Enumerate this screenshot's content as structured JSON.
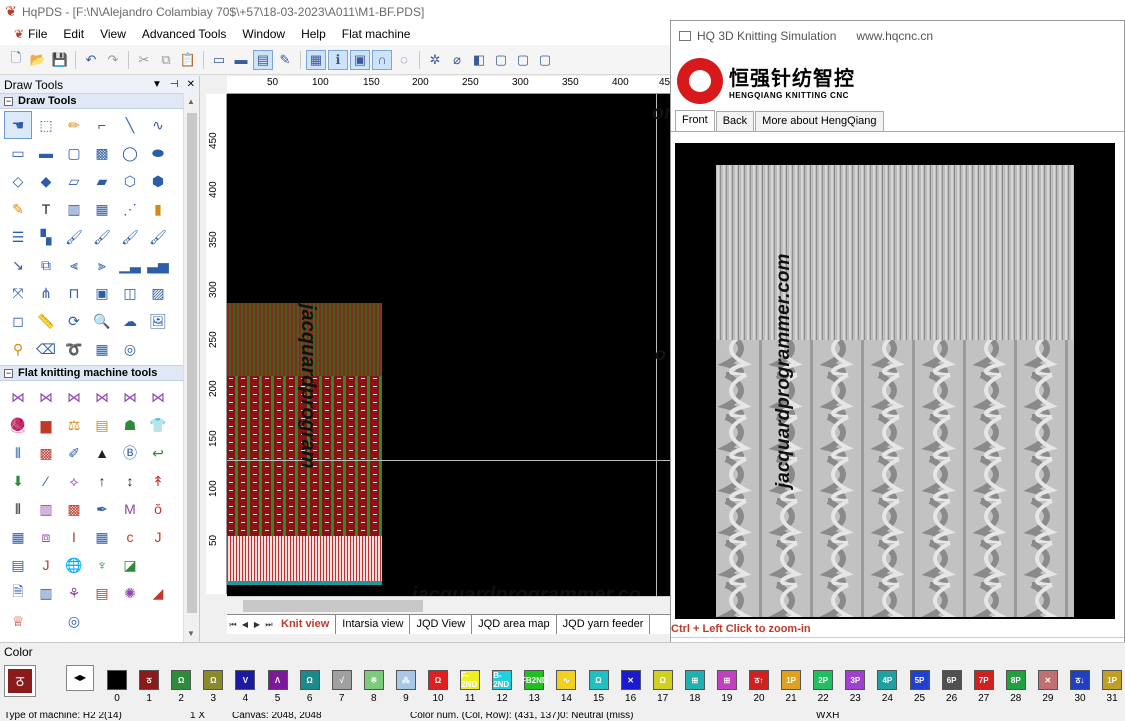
{
  "window": {
    "title": "HqPDS - [F:\\N\\Alejandro Colambiay 70$\\+57\\18-03-2023\\A011\\M1-BF.PDS]"
  },
  "menu": [
    "File",
    "Edit",
    "View",
    "Advanced Tools",
    "Window",
    "Help",
    "Flat machine"
  ],
  "left_panel": {
    "title": "Draw Tools",
    "section1": "Draw Tools",
    "section2": "Flat knitting machine tools"
  },
  "ruler": {
    "h_labels": [
      "50",
      "100",
      "150",
      "200",
      "250",
      "300",
      "350",
      "400",
      "45"
    ],
    "v_labels": [
      "450",
      "400",
      "350",
      "300",
      "250",
      "200",
      "150",
      "100",
      "50"
    ]
  },
  "canvas": {
    "watermark_vertical": "jacquardprogram",
    "watermark_bottom": "jacquardprogrammer.co",
    "watermark_top": "om",
    "watermark_mid": "o"
  },
  "tabs": [
    "Knit view",
    "Intarsia view",
    "JQD View",
    "JQD area map",
    "JQD yarn feeder"
  ],
  "sim": {
    "title": "HQ 3D Knitting Simulation",
    "url": "www.hqcnc.cn",
    "brand_cn": "恒强针纺智控",
    "brand_en": "HENGQIANG KNITTING CNC",
    "tabs": [
      "Front",
      "Back",
      "More about HengQiang"
    ],
    "watermark": "jacquardprogrammer.com",
    "hint": "Ctrl + Left Click to zoom-in"
  },
  "colorbar": {
    "label": "Color",
    "swatches": [
      {
        "n": "0",
        "color": "#000000",
        "t": ""
      },
      {
        "n": "1",
        "color": "#8b1a1a",
        "t": "ठ"
      },
      {
        "n": "2",
        "color": "#2e8b3a",
        "t": "Ω"
      },
      {
        "n": "3",
        "color": "#8a8a2a",
        "t": "Ω"
      },
      {
        "n": "4",
        "color": "#1a1aa0",
        "t": "V"
      },
      {
        "n": "5",
        "color": "#7a1a9a",
        "t": "Λ"
      },
      {
        "n": "6",
        "color": "#1a8a8a",
        "t": "Ω"
      },
      {
        "n": "7",
        "color": "#a0a0a0",
        "t": "√"
      },
      {
        "n": "8",
        "color": "#7acb7a",
        "t": "※"
      },
      {
        "n": "9",
        "color": "#a6c8e6",
        "t": "⁂"
      },
      {
        "n": "10",
        "color": "#e02020",
        "t": "Ω"
      },
      {
        "n": "11",
        "color": "#f0f020",
        "t": "F-2ND"
      },
      {
        "n": "12",
        "color": "#20d0e0",
        "t": "B-2ND"
      },
      {
        "n": "13",
        "color": "#20c020",
        "t": "FB2ND"
      },
      {
        "n": "14",
        "color": "#f0d020",
        "t": "∿"
      },
      {
        "n": "15",
        "color": "#20c0c0",
        "t": "Ω"
      },
      {
        "n": "16",
        "color": "#1a1ad0",
        "t": "✕"
      },
      {
        "n": "17",
        "color": "#d0d020",
        "t": "Ω"
      },
      {
        "n": "18",
        "color": "#20b0b0",
        "t": "⊞"
      },
      {
        "n": "19",
        "color": "#c040c0",
        "t": "⊞"
      },
      {
        "n": "20",
        "color": "#d02020",
        "t": "ठ↑"
      },
      {
        "n": "21",
        "color": "#e0a020",
        "t": "1P"
      },
      {
        "n": "22",
        "color": "#20c060",
        "t": "2P"
      },
      {
        "n": "23",
        "color": "#a040d0",
        "t": "3P"
      },
      {
        "n": "24",
        "color": "#20a0a0",
        "t": "4P"
      },
      {
        "n": "25",
        "color": "#2040d0",
        "t": "5P"
      },
      {
        "n": "26",
        "color": "#505050",
        "t": "6P"
      },
      {
        "n": "27",
        "color": "#d02020",
        "t": "7P"
      },
      {
        "n": "28",
        "color": "#20a040",
        "t": "8P"
      },
      {
        "n": "29",
        "color": "#c07070",
        "t": "✕"
      },
      {
        "n": "30",
        "color": "#2040c0",
        "t": "ठ↓"
      },
      {
        "n": "31",
        "color": "#c0a020",
        "t": "1P"
      }
    ]
  },
  "status": {
    "machine": "Type of machine: H2 2(14)",
    "zoom": "1 X",
    "canvas": "Canvas: 2048, 2048",
    "color": "Color num. (Col, Row): (431, 137)0: Neutral (miss)",
    "wxh": "WXH"
  }
}
